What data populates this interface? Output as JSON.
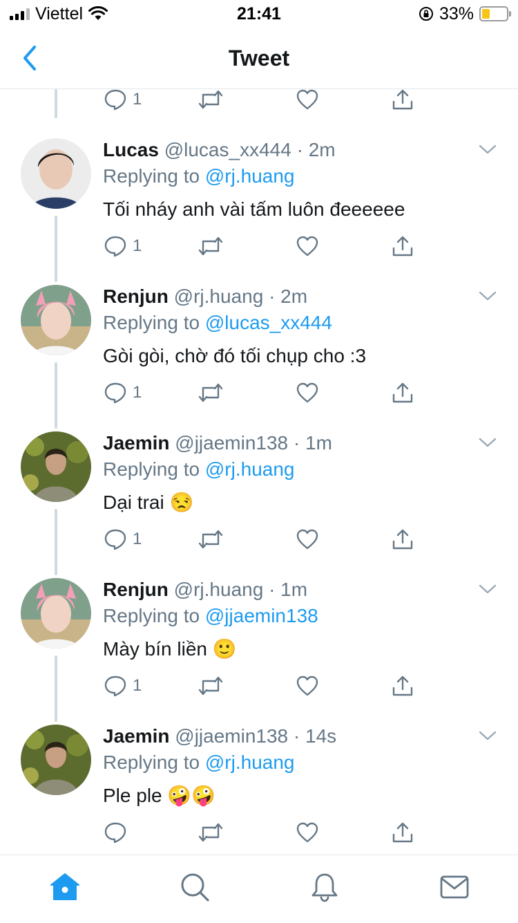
{
  "status_bar": {
    "carrier": "Viettel",
    "time": "21:41",
    "battery": "33%"
  },
  "nav": {
    "title": "Tweet"
  },
  "top_partial": {
    "reply_count": "1"
  },
  "tweets": [
    {
      "name": "Lucas",
      "handle": "@lucas_xx444",
      "dot": "·",
      "time": "2m",
      "replying_prefix": "Replying to",
      "replying_to": "@rj.huang",
      "text": "Tối nháy anh vài tấm luôn đeeeeee",
      "reply_count": "1"
    },
    {
      "name": "Renjun",
      "handle": "@rj.huang",
      "dot": "·",
      "time": "2m",
      "replying_prefix": "Replying to",
      "replying_to": "@lucas_xx444",
      "text": "Gòi gòi, chờ đó tối chụp cho :3",
      "reply_count": "1"
    },
    {
      "name": "Jaemin",
      "handle": "@jjaemin138",
      "dot": "·",
      "time": "1m",
      "replying_prefix": "Replying to",
      "replying_to": "@rj.huang",
      "text": "Dại trai 😒",
      "reply_count": "1"
    },
    {
      "name": "Renjun",
      "handle": "@rj.huang",
      "dot": "·",
      "time": "1m",
      "replying_prefix": "Replying to",
      "replying_to": "@jjaemin138",
      "text": "Mày bín liền 🙂",
      "reply_count": "1"
    },
    {
      "name": "Jaemin",
      "handle": "@jjaemin138",
      "dot": "·",
      "time": "14s",
      "replying_prefix": "Replying to",
      "replying_to": "@rj.huang",
      "text": "Ple ple 🤪🤪",
      "reply_count": ""
    }
  ],
  "tabbar": {
    "items": [
      "home-icon",
      "search-icon",
      "notifications-icon",
      "messages-icon"
    ]
  },
  "colors": {
    "accent": "#1d9bf0",
    "secondary_text": "#657786",
    "divider": "#e1e8ed"
  }
}
